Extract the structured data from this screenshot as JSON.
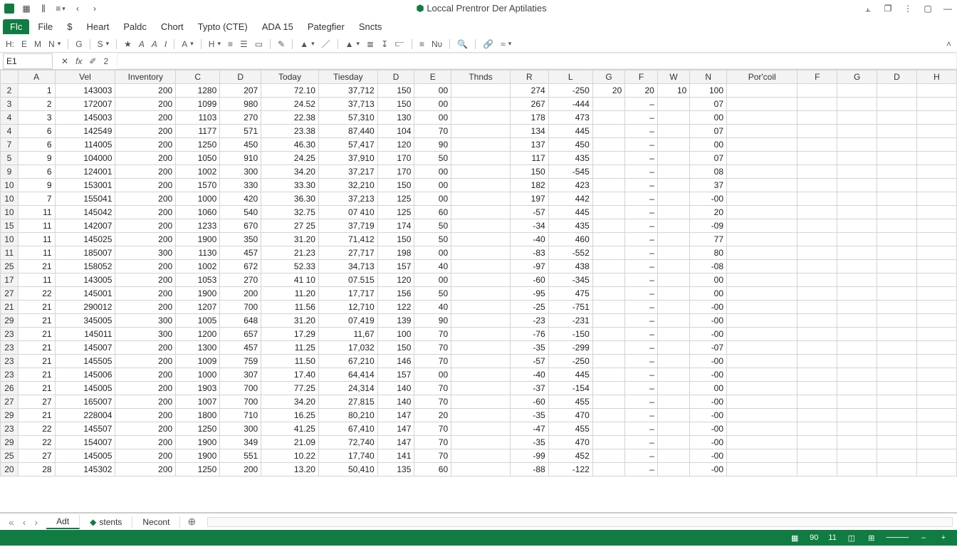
{
  "title": "Loccal Prentror Der Aptilaties",
  "title_prefix_icon": "autosave-icon",
  "menubar": {
    "file": "Flc",
    "items": [
      "File",
      "$",
      "Heart",
      "Paldc",
      "Chort",
      "Typto (CTE)",
      "ADA 15",
      "Pategfier",
      "Sncts"
    ]
  },
  "toolbar_letters": [
    "H:",
    "E",
    "M",
    "N",
    "G",
    "S",
    "A",
    "A",
    "I",
    "A",
    "H",
    "E",
    "A",
    "H",
    "E",
    "N",
    "A"
  ],
  "name_box": "E1",
  "fx_label": "fx",
  "fx_alt": "2",
  "sheettabs": {
    "nav": [
      "«",
      "‹",
      "›"
    ],
    "tabs": [
      "Adt",
      "stents",
      "Necont"
    ],
    "add": "+"
  },
  "statusbar": {
    "items": [
      "90",
      "11"
    ]
  },
  "columns": [
    {
      "key": "rowhdr",
      "label": "",
      "cls": "corner"
    },
    {
      "key": "A",
      "label": "A",
      "cls": "col-A"
    },
    {
      "key": "Vel",
      "label": "Vel",
      "cls": "col-Vel",
      "bold": true
    },
    {
      "key": "Inv",
      "label": "Inventory",
      "cls": "col-Inv",
      "bold": true
    },
    {
      "key": "C",
      "label": "C",
      "cls": "col-C"
    },
    {
      "key": "D1",
      "label": "D",
      "cls": "col-D1"
    },
    {
      "key": "Tod",
      "label": "Today",
      "cls": "col-Tod",
      "bold": true
    },
    {
      "key": "Tie",
      "label": "Tiesday",
      "cls": "col-Tie",
      "bold": true
    },
    {
      "key": "D2",
      "label": "D",
      "cls": "col-D2"
    },
    {
      "key": "E",
      "label": "E",
      "cls": "col-E"
    },
    {
      "key": "Thn",
      "label": "Thnds",
      "cls": "col-Thn",
      "bold": true
    },
    {
      "key": "R",
      "label": "R",
      "cls": "col-R"
    },
    {
      "key": "L",
      "label": "L",
      "cls": "col-L"
    },
    {
      "key": "G",
      "label": "G",
      "cls": "col-G"
    },
    {
      "key": "F1",
      "label": "F",
      "cls": "col-F1"
    },
    {
      "key": "W",
      "label": "W",
      "cls": "col-W"
    },
    {
      "key": "N",
      "label": "N",
      "cls": "col-N"
    },
    {
      "key": "Por",
      "label": "Por'coil",
      "cls": "col-Por",
      "bold": true
    },
    {
      "key": "x1",
      "label": "F",
      "cls": "col-ext"
    },
    {
      "key": "x2",
      "label": "G",
      "cls": "col-ext"
    },
    {
      "key": "x3",
      "label": "D",
      "cls": "col-ext"
    },
    {
      "key": "x4",
      "label": "H",
      "cls": "col-ext"
    }
  ],
  "rows": [
    {
      "rh": "2",
      "A": "1",
      "Vel": "143003",
      "Inv": "200",
      "C": "1280",
      "D1": "207",
      "Tod": "72.10",
      "Tie": "37,712",
      "D2": "150",
      "E": "00",
      "Thn": "",
      "R": "274",
      "L": "-250",
      "G": "20",
      "F1": "20",
      "W": "10",
      "N": "100",
      "Por": ""
    },
    {
      "rh": "3",
      "A": "2",
      "Vel": "172007",
      "Inv": "200",
      "C": "1099",
      "D1": "980",
      "Tod": "24.52",
      "Tie": "37,713",
      "D2": "150",
      "E": "00",
      "Thn": "",
      "R": "267",
      "L": "-444",
      "G": "",
      "F1": "–",
      "W": "",
      "N": "07",
      "Por": ""
    },
    {
      "rh": "4",
      "A": "3",
      "Vel": "145003",
      "Inv": "200",
      "C": "1103",
      "D1": "270",
      "Tod": "22.38",
      "Tie": "57,310",
      "D2": "130",
      "E": "00",
      "Thn": "",
      "R": "178",
      "L": "473",
      "G": "",
      "F1": "–",
      "W": "",
      "N": "00",
      "Por": ""
    },
    {
      "rh": "4",
      "A": "6",
      "Vel": "142549",
      "Inv": "200",
      "C": "1177",
      "D1": "571",
      "Tod": "23.38",
      "Tie": "87,440",
      "D2": "104",
      "E": "70",
      "Thn": "",
      "R": "134",
      "L": "445",
      "G": "",
      "F1": "–",
      "W": "",
      "N": "07",
      "Por": ""
    },
    {
      "rh": "7",
      "A": "6",
      "Vel": "114005",
      "Inv": "200",
      "C": "1250",
      "D1": "450",
      "Tod": "46.30",
      "Tie": "57,417",
      "D2": "120",
      "E": "90",
      "Thn": "",
      "R": "137",
      "L": "450",
      "G": "",
      "F1": "–",
      "W": "",
      "N": "00",
      "Por": ""
    },
    {
      "rh": "5",
      "A": "9",
      "Vel": "104000",
      "Inv": "200",
      "C": "1050",
      "D1": "910",
      "Tod": "24.25",
      "Tie": "37,910",
      "D2": "170",
      "E": "50",
      "Thn": "",
      "R": "117",
      "L": "435",
      "G": "",
      "F1": "–",
      "W": "",
      "N": "07",
      "Por": ""
    },
    {
      "rh": "9",
      "A": "6",
      "Vel": "124001",
      "Inv": "200",
      "C": "1002",
      "D1": "300",
      "Tod": "34.20",
      "Tie": "37,217",
      "D2": "170",
      "E": "00",
      "Thn": "",
      "R": "150",
      "L": "-545",
      "G": "",
      "F1": "–",
      "W": "",
      "N": "08",
      "Por": ""
    },
    {
      "rh": "10",
      "A": "9",
      "Vel": "153001",
      "Inv": "200",
      "C": "1570",
      "D1": "330",
      "Tod": "33.30",
      "Tie": "32,210",
      "D2": "150",
      "E": "00",
      "Thn": "",
      "R": "182",
      "L": "423",
      "G": "",
      "F1": "–",
      "W": "",
      "N": "37",
      "Por": ""
    },
    {
      "rh": "10",
      "A": "7",
      "Vel": "155041",
      "Inv": "200",
      "C": "1000",
      "D1": "420",
      "Tod": "36.30",
      "Tie": "37,213",
      "D2": "125",
      "E": "00",
      "Thn": "",
      "R": "197",
      "L": "442",
      "G": "",
      "F1": "–",
      "W": "",
      "N": "-00",
      "Por": ""
    },
    {
      "rh": "10",
      "A": "11",
      "Vel": "145042",
      "Inv": "200",
      "C": "1060",
      "D1": "540",
      "Tod": "32.75",
      "Tie": "07 410",
      "D2": "125",
      "E": "60",
      "Thn": "",
      "R": "-57",
      "L": "445",
      "G": "",
      "F1": "–",
      "W": "",
      "N": "20",
      "Por": ""
    },
    {
      "rh": "15",
      "A": "11",
      "Vel": "142007",
      "Inv": "200",
      "C": "1233",
      "D1": "670",
      "Tod": "27 25",
      "Tie": "37,719",
      "D2": "174",
      "E": "50",
      "Thn": "",
      "R": "-34",
      "L": "435",
      "G": "",
      "F1": "–",
      "W": "",
      "N": "-09",
      "Por": ""
    },
    {
      "rh": "10",
      "A": "11",
      "Vel": "145025",
      "Inv": "200",
      "C": "1900",
      "D1": "350",
      "Tod": "31.20",
      "Tie": "71,412",
      "D2": "150",
      "E": "50",
      "Thn": "",
      "R": "-40",
      "L": "460",
      "G": "",
      "F1": "–",
      "W": "",
      "N": "77",
      "Por": ""
    },
    {
      "rh": "11",
      "A": "11",
      "Vel": "185007",
      "Inv": "300",
      "C": "1130",
      "D1": "457",
      "Tod": "21.23",
      "Tie": "27,717",
      "D2": "198",
      "E": "00",
      "Thn": "",
      "R": "-83",
      "L": "-552",
      "G": "",
      "F1": "–",
      "W": "",
      "N": "80",
      "Por": ""
    },
    {
      "rh": "25",
      "A": "21",
      "Vel": "158052",
      "Inv": "200",
      "C": "1002",
      "D1": "672",
      "Tod": "52.33",
      "Tie": "34,713",
      "D2": "157",
      "E": "40",
      "Thn": "",
      "R": "-97",
      "L": "438",
      "G": "",
      "F1": "–",
      "W": "",
      "N": "-08",
      "Por": ""
    },
    {
      "rh": "17",
      "A": "11",
      "Vel": "143005",
      "Inv": "200",
      "C": "1053",
      "D1": "270",
      "Tod": "41 10",
      "Tie": "07.515",
      "D2": "120",
      "E": "00",
      "Thn": "",
      "R": "-60",
      "L": "-345",
      "G": "",
      "F1": "–",
      "W": "",
      "N": "00",
      "Por": ""
    },
    {
      "rh": "27",
      "A": "22",
      "Vel": "145001",
      "Inv": "200",
      "C": "1900",
      "D1": "200",
      "Tod": "11.20",
      "Tie": "17,717",
      "D2": "156",
      "E": "50",
      "Thn": "",
      "R": "-95",
      "L": "475",
      "G": "",
      "F1": "–",
      "W": "",
      "N": "00",
      "Por": ""
    },
    {
      "rh": "21",
      "A": "21",
      "Vel": "290012",
      "Inv": "200",
      "C": "1207",
      "D1": "700",
      "Tod": "11.56",
      "Tie": "12,710",
      "D2": "122",
      "E": "40",
      "Thn": "",
      "R": "-25",
      "L": "-751",
      "G": "",
      "F1": "–",
      "W": "",
      "N": "-00",
      "Por": ""
    },
    {
      "rh": "29",
      "A": "21",
      "Vel": "345005",
      "Inv": "300",
      "C": "1005",
      "D1": "648",
      "Tod": "31.20",
      "Tie": "07,419",
      "D2": "139",
      "E": "90",
      "Thn": "",
      "R": "-23",
      "L": "-231",
      "G": "",
      "F1": "–",
      "W": "",
      "N": "-00",
      "Por": ""
    },
    {
      "rh": "23",
      "A": "21",
      "Vel": "145011",
      "Inv": "300",
      "C": "1200",
      "D1": "657",
      "Tod": "17.29",
      "Tie": "11,67",
      "D2": "100",
      "E": "70",
      "Thn": "",
      "R": "-76",
      "L": "-150",
      "G": "",
      "F1": "–",
      "W": "",
      "N": "-00",
      "Por": ""
    },
    {
      "rh": "23",
      "A": "21",
      "Vel": "145007",
      "Inv": "200",
      "C": "1300",
      "D1": "457",
      "Tod": "11.25",
      "Tie": "17,032",
      "D2": "150",
      "E": "70",
      "Thn": "",
      "R": "-35",
      "L": "-299",
      "G": "",
      "F1": "–",
      "W": "",
      "N": "-07",
      "Por": ""
    },
    {
      "rh": "23",
      "A": "21",
      "Vel": "145505",
      "Inv": "200",
      "C": "1009",
      "D1": "759",
      "Tod": "11.50",
      "Tie": "67,210",
      "D2": "146",
      "E": "70",
      "Thn": "",
      "R": "-57",
      "L": "-250",
      "G": "",
      "F1": "–",
      "W": "",
      "N": "-00",
      "Por": ""
    },
    {
      "rh": "23",
      "A": "21",
      "Vel": "145006",
      "Inv": "200",
      "C": "1000",
      "D1": "307",
      "Tod": "17.40",
      "Tie": "64,414",
      "D2": "157",
      "E": "00",
      "Thn": "",
      "R": "-40",
      "L": "445",
      "G": "",
      "F1": "–",
      "W": "",
      "N": "-00",
      "Por": ""
    },
    {
      "rh": "26",
      "A": "21",
      "Vel": "145005",
      "Inv": "200",
      "C": "1903",
      "D1": "700",
      "Tod": "77.25",
      "Tie": "24,314",
      "D2": "140",
      "E": "70",
      "Thn": "",
      "R": "-37",
      "L": "-154",
      "G": "",
      "F1": "–",
      "W": "",
      "N": "00",
      "Por": ""
    },
    {
      "rh": "27",
      "A": "27",
      "Vel": "165007",
      "Inv": "200",
      "C": "1007",
      "D1": "700",
      "Tod": "34.20",
      "Tie": "27,815",
      "D2": "140",
      "E": "70",
      "Thn": "",
      "R": "-60",
      "L": "455",
      "G": "",
      "F1": "–",
      "W": "",
      "N": "-00",
      "Por": ""
    },
    {
      "rh": "29",
      "A": "21",
      "Vel": "228004",
      "Inv": "200",
      "C": "1800",
      "D1": "710",
      "Tod": "16.25",
      "Tie": "80,210",
      "D2": "147",
      "E": "20",
      "Thn": "",
      "R": "-35",
      "L": "470",
      "G": "",
      "F1": "–",
      "W": "",
      "N": "-00",
      "Por": ""
    },
    {
      "rh": "23",
      "A": "22",
      "Vel": "145507",
      "Inv": "200",
      "C": "1250",
      "D1": "300",
      "Tod": "41.25",
      "Tie": "67,410",
      "D2": "147",
      "E": "70",
      "Thn": "",
      "R": "-47",
      "L": "455",
      "G": "",
      "F1": "–",
      "W": "",
      "N": "-00",
      "Por": ""
    },
    {
      "rh": "29",
      "A": "22",
      "Vel": "154007",
      "Inv": "200",
      "C": "1900",
      "D1": "349",
      "Tod": "21.09",
      "Tie": "72,740",
      "D2": "147",
      "E": "70",
      "Thn": "",
      "R": "-35",
      "L": "470",
      "G": "",
      "F1": "–",
      "W": "",
      "N": "-00",
      "Por": ""
    },
    {
      "rh": "25",
      "A": "27",
      "Vel": "145005",
      "Inv": "200",
      "C": "1900",
      "D1": "551",
      "Tod": "10.22",
      "Tie": "17,740",
      "D2": "141",
      "E": "70",
      "Thn": "",
      "R": "-99",
      "L": "452",
      "G": "",
      "F1": "–",
      "W": "",
      "N": "-00",
      "Por": ""
    },
    {
      "rh": "20",
      "A": "28",
      "Vel": "145302",
      "Inv": "200",
      "C": "1250",
      "D1": "200",
      "Tod": "13.20",
      "Tie": "50,410",
      "D2": "135",
      "E": "60",
      "Thn": "",
      "R": "-88",
      "L": "-122",
      "G": "",
      "F1": "–",
      "W": "",
      "N": "-00",
      "Por": ""
    }
  ]
}
